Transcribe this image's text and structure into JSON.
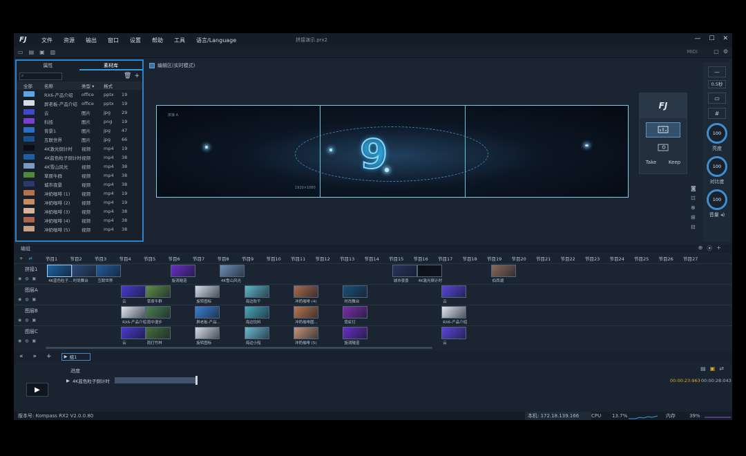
{
  "menubar": {
    "logo": "FJ",
    "items": [
      "文件",
      "资源",
      "输出",
      "窗口",
      "设置",
      "帮助",
      "工具",
      "语言/Language"
    ],
    "doc_title": "拼接演示.prx2",
    "window_controls": [
      "—",
      "☐",
      "✕"
    ]
  },
  "toolbar": {
    "midi": "MIDI"
  },
  "left_panel": {
    "tabs": [
      "属性",
      "素材库"
    ],
    "active_tab": "素材库",
    "columns": [
      "全部",
      "名称",
      "类型",
      "格式"
    ],
    "rows": [
      {
        "name": "RX6-产品介绍",
        "type": "office",
        "format": "pptx",
        "n": "19",
        "color": "#5da6e0"
      },
      {
        "name": "屏老板-产品介绍",
        "type": "office",
        "format": "pptx",
        "n": "19",
        "color": "#d5dde6"
      },
      {
        "name": "云",
        "type": "图片",
        "format": "jpg",
        "n": "29",
        "color": "#3f48c8"
      },
      {
        "name": "科技",
        "type": "图片",
        "format": "png",
        "n": "19",
        "color": "#7a3fd1"
      },
      {
        "name": "背景1",
        "type": "图片",
        "format": "jpg",
        "n": "47",
        "color": "#2d6fc4"
      },
      {
        "name": "互联世界",
        "type": "图片",
        "format": "jpg",
        "n": "66",
        "color": "#1a4f8f"
      },
      {
        "name": "4K激光倒计时",
        "type": "视频",
        "format": "mp4",
        "n": "19",
        "color": "#0a0e16"
      },
      {
        "name": "4K蓝色粒子倒计时",
        "type": "视频",
        "format": "mp4",
        "n": "38",
        "color": "#1e5ea8"
      },
      {
        "name": "4K雪山风光",
        "type": "视频",
        "format": "mp4",
        "n": "38",
        "color": "#7a9cc2"
      },
      {
        "name": "草原牛群",
        "type": "视频",
        "format": "mp4",
        "n": "38",
        "color": "#4f8a3a"
      },
      {
        "name": "城市夜景",
        "type": "视频",
        "format": "mp4",
        "n": "38",
        "color": "#2c3a6a"
      },
      {
        "name": "冲奶咖啡 (1)",
        "type": "视频",
        "format": "mp4",
        "n": "19",
        "color": "#b5714a"
      },
      {
        "name": "冲奶咖啡 (2)",
        "type": "视频",
        "format": "mp4",
        "n": "19",
        "color": "#c78b64"
      },
      {
        "name": "冲奶咖啡 (3)",
        "type": "视频",
        "format": "mp4",
        "n": "38",
        "color": "#d9b29a"
      },
      {
        "name": "冲奶咖啡 (4)",
        "type": "视频",
        "format": "mp4",
        "n": "38",
        "color": "#a66547"
      },
      {
        "name": "冲奶咖啡 (5)",
        "type": "视频",
        "format": "mp4",
        "n": "38",
        "color": "#caa088"
      }
    ]
  },
  "editor": {
    "header": "编辑区(实时模式)",
    "stage_number": "9",
    "stage_label_top": "拼接 A",
    "stage_label_bottom": "1920×1080"
  },
  "control": {
    "take": "Take",
    "keep": "Keep"
  },
  "right_panel": {
    "speed": "0.5秒",
    "brightness": {
      "value": "100",
      "label": "亮度"
    },
    "contrast": {
      "value": "100",
      "label": "对比度"
    },
    "volume": {
      "value": "100",
      "label": "音量"
    }
  },
  "timeline": {
    "header": "编组",
    "programs": [
      "节目1",
      "节目2",
      "节目3",
      "节目4",
      "节目5",
      "节目6",
      "节目7",
      "节目8",
      "节目9",
      "节目10",
      "节目11",
      "节目12",
      "节目13",
      "节目14",
      "节目15",
      "节目16",
      "节目17",
      "节目18",
      "节目19",
      "节目20",
      "节目21",
      "节目22",
      "节目23",
      "节目24",
      "节目25",
      "节目26",
      "节目27"
    ],
    "tracks": [
      {
        "label": "拼接1",
        "clips": [
          {
            "col": 0,
            "name": "4K蓝色粒子...",
            "color": "#1f62a6",
            "sel": true
          },
          {
            "col": 1,
            "name": "时尚舞台",
            "color": "#2e4a78",
            "sel": false
          },
          {
            "col": 2,
            "name": "互联世界",
            "color": "#255a9a",
            "sel": false
          },
          {
            "col": 5,
            "name": "旋涡隧道",
            "color": "#6a2ec4",
            "sel": false
          },
          {
            "col": 7,
            "name": "4K雪山风光",
            "color": "#6d8db4",
            "sel": false
          },
          {
            "col": 14,
            "name": "城市夜景",
            "color": "#2a3560",
            "sel": false
          },
          {
            "col": 15,
            "name": "4K激光倒计时",
            "color": "#0b0f18",
            "sel": false
          },
          {
            "col": 18,
            "name": "伯西湖",
            "color": "#8a6a5a",
            "sel": false
          }
        ]
      },
      {
        "label": "图层A",
        "clips": [
          {
            "col": 3,
            "name": "云",
            "color": "#4b3ad0",
            "sel": false
          },
          {
            "col": 4,
            "name": "草原牛群",
            "color": "#5e8e46",
            "sel": false
          },
          {
            "col": 6,
            "name": "旋转图标",
            "color": "#d6dde6",
            "sel": false
          },
          {
            "col": 8,
            "name": "海边秋千",
            "color": "#5fb7c9",
            "sel": false
          },
          {
            "col": 10,
            "name": "冲奶咖啡 (4)",
            "color": "#a96a4c",
            "sel": false
          },
          {
            "col": 12,
            "name": "时尚舞台",
            "color": "#1d4f78",
            "sel": false
          },
          {
            "col": 16,
            "name": "云",
            "color": "#5a46d8",
            "sel": false
          }
        ]
      },
      {
        "label": "图层B",
        "clips": [
          {
            "col": 3,
            "name": "RX6-产品介绍",
            "color": "#dfe6ee",
            "sel": false
          },
          {
            "col": 4,
            "name": "雨中漫步",
            "color": "#4e7f52",
            "sel": false
          },
          {
            "col": 6,
            "name": "屏老板-产品...",
            "color": "#3b7fd2",
            "sel": false
          },
          {
            "col": 8,
            "name": "海边饮料",
            "color": "#4aa7b9",
            "sel": false
          },
          {
            "col": 10,
            "name": "冲奶咖啡圆...",
            "color": "#b9764f",
            "sel": false
          },
          {
            "col": 12,
            "name": "霓虹灯",
            "color": "#7a2fa8",
            "sel": false
          },
          {
            "col": 16,
            "name": "RX6-产品介绍",
            "color": "#dfe6ee",
            "sel": false
          }
        ]
      },
      {
        "label": "图层C",
        "clips": [
          {
            "col": 3,
            "name": "云",
            "color": "#4b3ad0",
            "sel": false
          },
          {
            "col": 4,
            "name": "雨打竹林",
            "color": "#466f3e",
            "sel": false
          },
          {
            "col": 6,
            "name": "旋转图标",
            "color": "#d6dde6",
            "sel": false
          },
          {
            "col": 8,
            "name": "海边小船",
            "color": "#6bbad0",
            "sel": false
          },
          {
            "col": 10,
            "name": "冲奶咖啡 (5)",
            "color": "#c49478",
            "sel": false
          },
          {
            "col": 12,
            "name": "旋涡隧道",
            "color": "#6a2ec4",
            "sel": false
          },
          {
            "col": 16,
            "name": "云",
            "color": "#5a46d8",
            "sel": false
          }
        ]
      }
    ],
    "group_tab": "组1"
  },
  "progress": {
    "label": "进度",
    "item": "4K蓝色粒子倒计时",
    "fraction": 0.75,
    "elapsed": "00:00:23:963",
    "total": "00:00:28:043"
  },
  "status": {
    "version": "版本号: Kompass RX2 V2.0.0.80",
    "host": "本机: 172.18.139.166",
    "cpu_label": "CPU",
    "cpu": "13.7%",
    "mem_label": "内存",
    "mem": "39%"
  }
}
